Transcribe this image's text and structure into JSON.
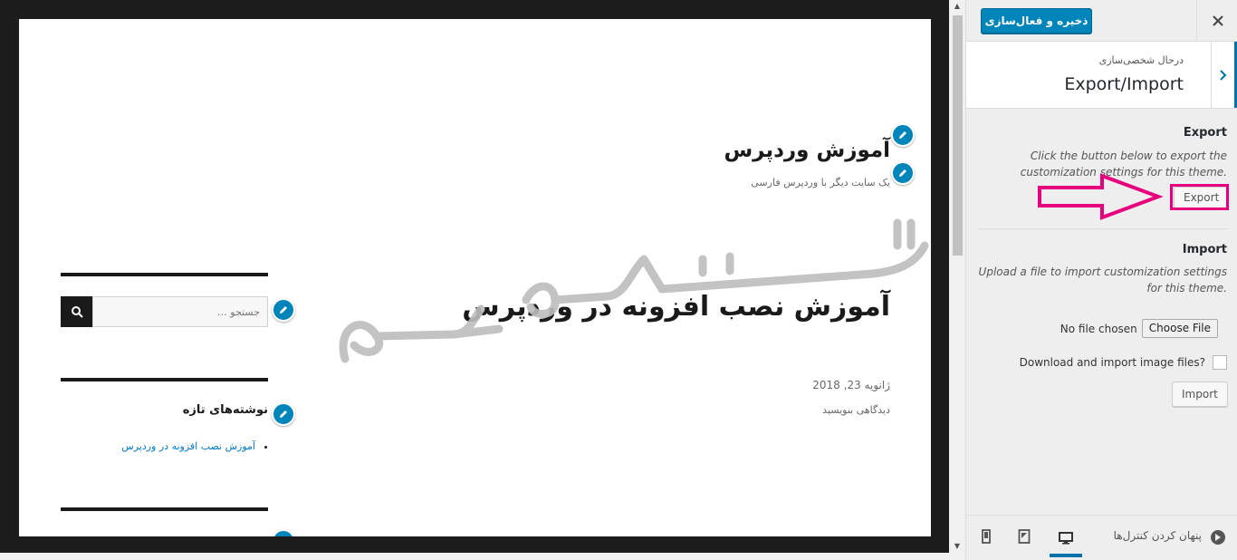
{
  "preview": {
    "site_title": "آموزش وردپرس",
    "site_description": "یک سایت دیگر با وردپرس فارسی",
    "post_title": "آموزش نصب افزونه در وردپرس",
    "post_date": "ژانویه 23, 2018",
    "post_comments": "دیدگاهی بنویسید",
    "search_placeholder": "جستجو …",
    "recent_posts_title": "نوشته‌های تازه",
    "recent_posts": [
      "آموزش نصب افزونه در وردپرس"
    ]
  },
  "sidebar": {
    "save_label": "ذخیره و فعال‌سازی",
    "close_icon": "close-icon",
    "customizing_label": "درحال شخصی‌سازی",
    "section_name": "Export/Import",
    "export": {
      "title": "Export",
      "description": "Click the button below to export the customization settings for this theme.",
      "button_label": "Export"
    },
    "import": {
      "title": "Import",
      "description": "Upload a file to import customization settings for this theme.",
      "no_file_label": "No file chosen",
      "choose_file_label": "Choose File",
      "download_images_label": "Download and import image files?",
      "download_images_checked": false,
      "button_label": "Import"
    },
    "footer": {
      "collapse_label": "پنهان کردن کنترل‌ها",
      "active_device": "desktop"
    }
  },
  "colors": {
    "accent": "#0085ba",
    "highlight": "#e6007e"
  }
}
